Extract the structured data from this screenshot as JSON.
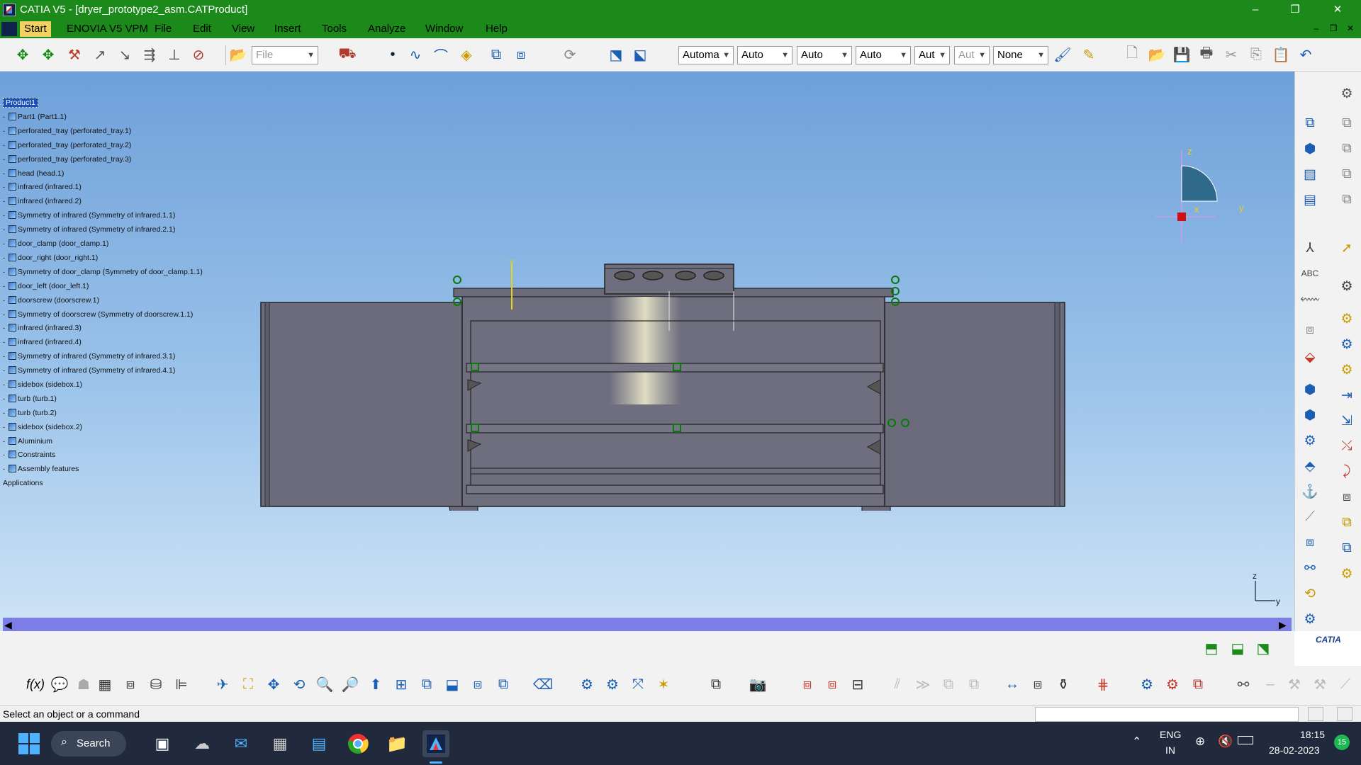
{
  "window": {
    "title": "CATIA V5 - [dryer_prototype2_asm.CATProduct]",
    "controls": {
      "minimize": "–",
      "maximize": "❐",
      "close": "✕"
    }
  },
  "menu": {
    "items": [
      "Start",
      "ENOVIA V5 VPM",
      "File",
      "Edit",
      "View",
      "Insert",
      "Tools",
      "Analyze",
      "Window",
      "Help"
    ],
    "mdi_controls": {
      "minimize": "–",
      "restore": "❐",
      "close": "✕"
    }
  },
  "toolbar": {
    "file_combo": "File",
    "combos": [
      "Automa",
      "Auto",
      "Auto",
      "Auto",
      "Aut",
      "Aut",
      "None"
    ]
  },
  "tree": {
    "root": "Product1",
    "nodes": [
      "Part1 (Part1.1)",
      "perforated_tray (perforated_tray.1)",
      "perforated_tray (perforated_tray.2)",
      "perforated_tray (perforated_tray.3)",
      "head (head.1)",
      "infrared (infrared.1)",
      "infrared (infrared.2)",
      "Symmetry of infrared (Symmetry of infrared.1.1)",
      "Symmetry of infrared (Symmetry of infrared.2.1)",
      "door_clamp (door_clamp.1)",
      "door_right (door_right.1)",
      "Symmetry of door_clamp (Symmetry of door_clamp.1.1)",
      "door_left (door_left.1)",
      "doorscrew (doorscrew.1)",
      "Symmetry of doorscrew (Symmetry of doorscrew.1.1)",
      "infrared (infrared.3)",
      "infrared (infrared.4)",
      "Symmetry of infrared (Symmetry of infrared.3.1)",
      "Symmetry of infrared (Symmetry of infrared.4.1)",
      "sidebox (sidebox.1)",
      "turb (turb.1)",
      "turb (turb.2)",
      "sidebox (sidebox.2)",
      "Aluminium",
      "Constraints",
      "Assembly features"
    ],
    "applications": "Applications"
  },
  "compass": {
    "z": "z",
    "y": "y",
    "x": "x"
  },
  "axis_small": {
    "z": "z",
    "y": "y"
  },
  "model_axis": {
    "y": "y"
  },
  "status": {
    "message": "Select an object or a command"
  },
  "taskbar": {
    "search": "Search",
    "lang": "ENG",
    "region": "IN",
    "time": "18:15",
    "date": "28-02-2023",
    "notif_count": "15"
  },
  "brand": {
    "catia": "CATIA"
  },
  "colors": {
    "titlebar": "#1b8a1b",
    "viewport_top": "#6ea0d9",
    "model": "#6b6b7c",
    "scrollbar": "#7d7de8"
  }
}
